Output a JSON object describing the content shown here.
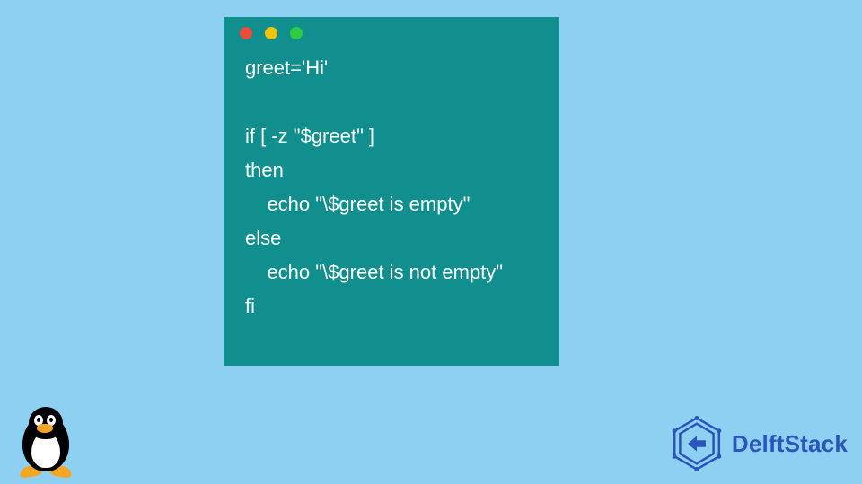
{
  "window": {
    "dots": [
      "red",
      "yellow",
      "green"
    ]
  },
  "code": {
    "lines": [
      "greet='Hi'",
      "",
      "if [ -z \"$greet\" ]",
      "then",
      "    echo \"\\$greet is empty\"",
      "else",
      "    echo \"\\$greet is not empty\"",
      "fi"
    ]
  },
  "logos": {
    "linux_icon": "tux-icon",
    "delftstack_label": "DelftStack"
  },
  "colors": {
    "background": "#8ed0f2",
    "window_bg": "#118f8f",
    "code_text": "#ffffff",
    "brand_blue": "#2b55b8"
  }
}
